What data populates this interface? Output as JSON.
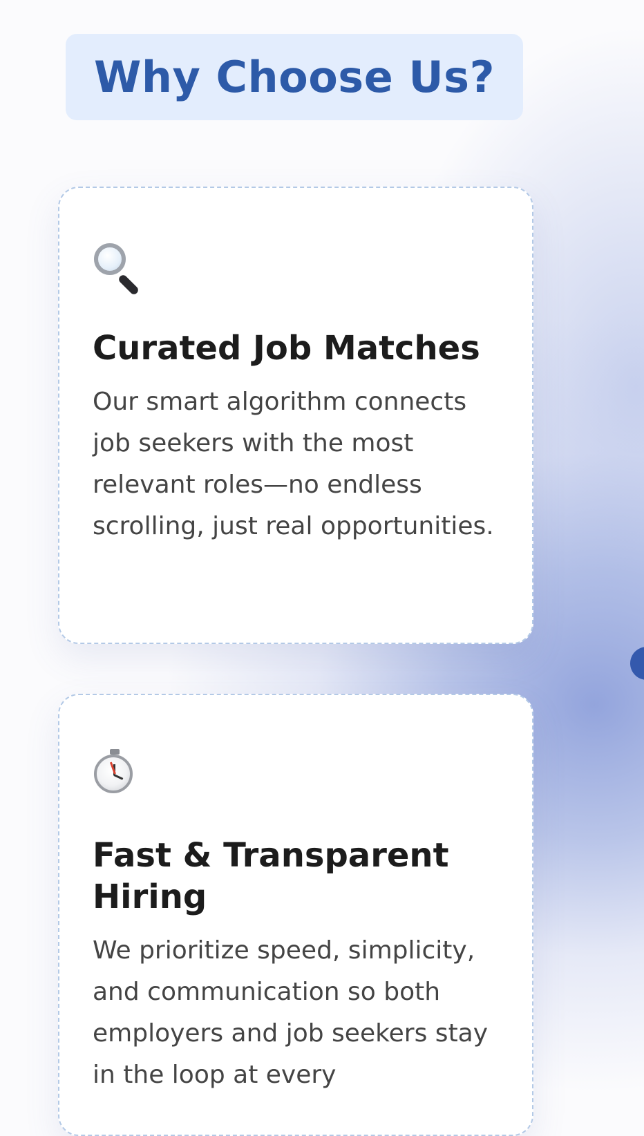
{
  "section": {
    "heading": "Why Choose Us?"
  },
  "features": [
    {
      "icon": "magnifying-glass-icon",
      "title": "Curated Job Matches",
      "description": "Our smart algorithm connects job seekers with the most relevant roles—no endless scrolling, just real opportunities."
    },
    {
      "icon": "stopwatch-icon",
      "title": "Fast & Transparent Hiring",
      "description": "We prioritize speed, simplicity, and communication so both employers and job seekers stay in the loop at every"
    }
  ],
  "colors": {
    "heading_text": "#2d5aa8",
    "heading_bg": "#e3edfd",
    "card_border": "#b3c9e6",
    "accent_dot": "#3459ad"
  }
}
